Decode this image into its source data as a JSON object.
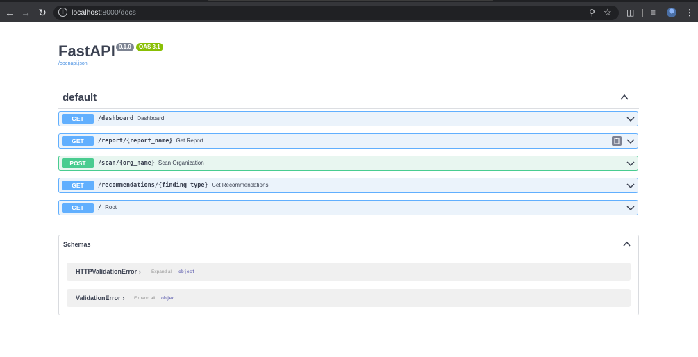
{
  "browser": {
    "url_host": "localhost",
    "url_rest": ":8000/docs",
    "back_icon": "arrow-left-icon",
    "forward_icon": "arrow-right-icon",
    "reload_icon": "reload-icon"
  },
  "api": {
    "title": "FastAPI",
    "version": "0.1.0",
    "oas": "OAS 3.1",
    "spec_link": "/openapi.json"
  },
  "tag": {
    "name": "default"
  },
  "operations": [
    {
      "method": "GET",
      "path": "/dashboard",
      "summary": "Dashboard"
    },
    {
      "method": "GET",
      "path": "/report/{report_name}",
      "summary": "Get Report"
    },
    {
      "method": "POST",
      "path": "/scan/{org_name}",
      "summary": "Scan Organization"
    },
    {
      "method": "GET",
      "path": "/recommendations/{finding_type}",
      "summary": "Get Recommendations"
    },
    {
      "method": "GET",
      "path": "/",
      "summary": "Root"
    }
  ],
  "schemas": {
    "title": "Schemas",
    "models": [
      {
        "name": "HTTPValidationError",
        "expand": "Expand all",
        "type": "object"
      },
      {
        "name": "ValidationError",
        "expand": "Expand all",
        "type": "object"
      }
    ]
  },
  "colors": {
    "get": "#61affe",
    "post": "#49cc90",
    "text": "#3b4151"
  }
}
